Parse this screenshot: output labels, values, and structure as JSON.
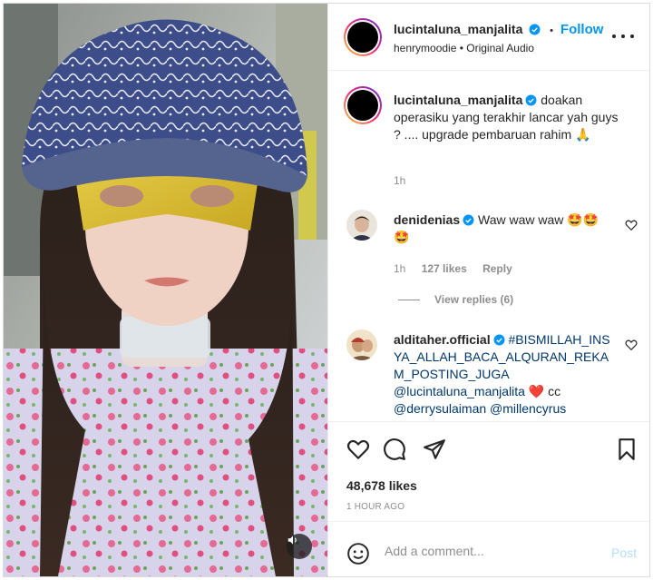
{
  "post": {
    "author": "lucintaluna_manjalita",
    "follow_label": "Follow",
    "dot": "•",
    "audio_info": "henrymoodie • Original Audio",
    "more_icon": "more-horizontal-icon",
    "sound_icon": "speaker-icon"
  },
  "comments": [
    {
      "user": "lucintaluna_manjalita",
      "text": "doakan operasiku yang terakhir lancar yah guys ? .... upgrade pembaruan rahim 🙏",
      "time": "1h"
    },
    {
      "user": "denidenias",
      "text": "Waw waw waw 🤩🤩🤩",
      "time": "1h",
      "likes": "127 likes",
      "reply_label": "Reply",
      "view_replies": "View replies (6)"
    },
    {
      "user": "alditaher.official",
      "hashtag": "#BISMILLAH_INSYA_ALLAH_BACA_ALQURAN_REKAM_POSTING_JUGA",
      "mention1": "@lucintaluna_manjalita",
      "heart": "❤️",
      "cc": " cc ",
      "mention2": "@derrysulaiman",
      "mention3": "@millencyrus"
    }
  ],
  "actions": {
    "like_icon": "heart-icon",
    "comment_icon": "comment-icon",
    "share_icon": "send-icon",
    "save_icon": "bookmark-icon"
  },
  "likes_count": "48,678 likes",
  "time_ago": "1 HOUR AGO",
  "add_comment": {
    "placeholder": "Add a comment...",
    "post_label": "Post"
  },
  "colors": {
    "accent": "#0095f6",
    "link": "#00376b",
    "muted": "#8e8e8e",
    "verified": "#0095f6"
  }
}
